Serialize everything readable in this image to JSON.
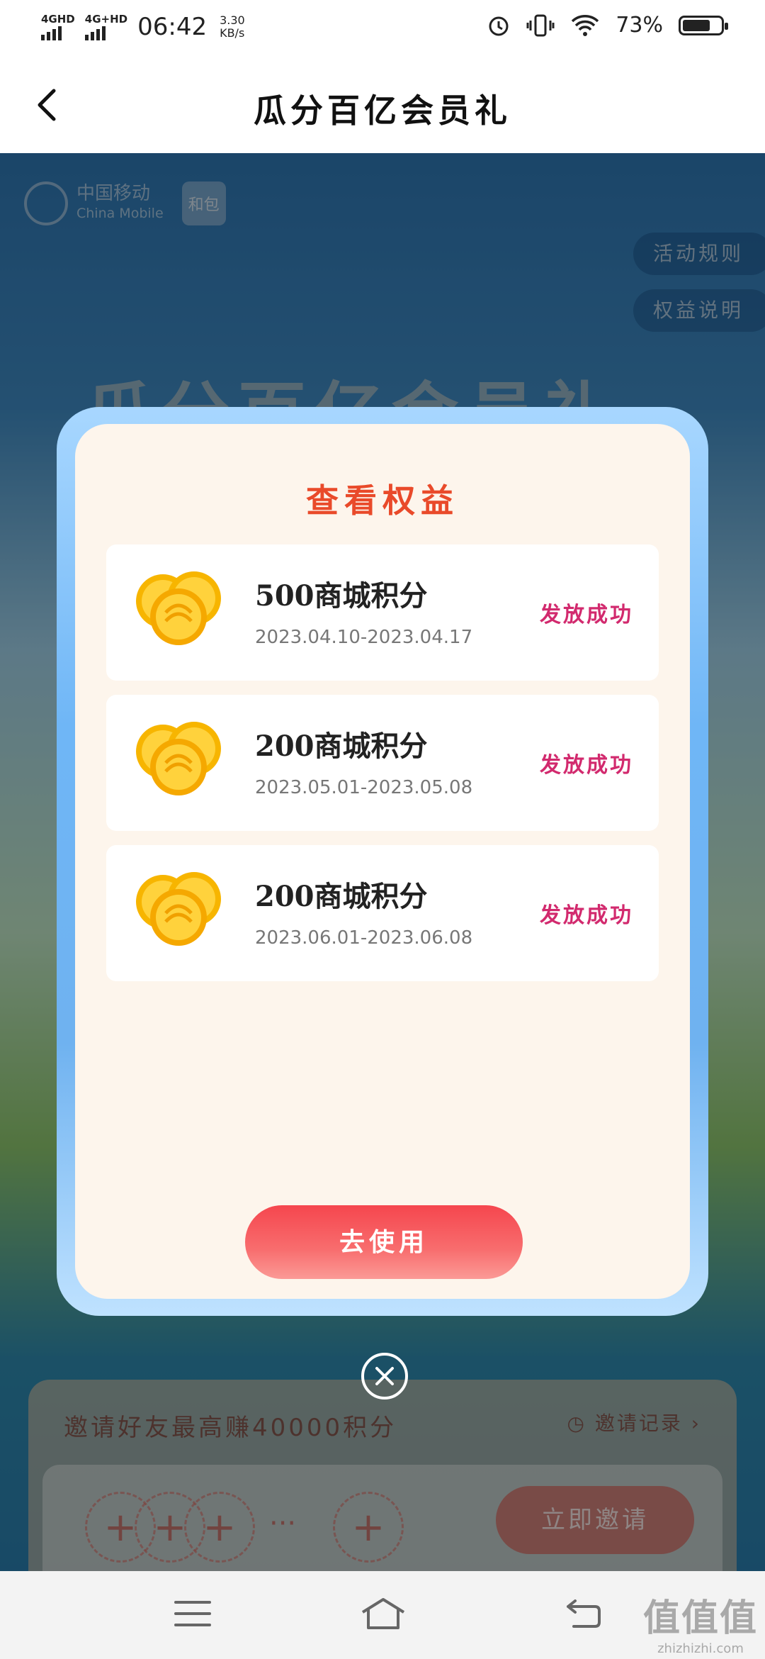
{
  "status_bar": {
    "network1": "4G",
    "network1_sup": "HD",
    "network2": "4G",
    "network2_sup": "+HD",
    "time": "06:42",
    "speed_value": "3.30",
    "speed_unit": "KB/s",
    "battery": "73%",
    "battery_level": 0.73
  },
  "header": {
    "title": "瓜分百亿会员礼",
    "back_icon": "chevron-left-icon"
  },
  "background_page": {
    "brand_cn": "中国移动",
    "brand_en": "China Mobile",
    "hebao": "和包",
    "rules_button": "活动规则",
    "benefits_button": "权益说明",
    "banner_title": "瓜分百亿会员礼",
    "invite_title": "邀请好友最高赚40000积分",
    "invite_record": "邀请记录",
    "invite_button": "立即邀请",
    "invite_more": "···"
  },
  "modal": {
    "title": "查看权益",
    "items": [
      {
        "name": "500商城积分",
        "period": "2023.04.10-2023.04.17",
        "status": "发放成功"
      },
      {
        "name": "200商城积分",
        "period": "2023.05.01-2023.05.08",
        "status": "发放成功"
      },
      {
        "name": "200商城积分",
        "period": "2023.06.01-2023.06.08",
        "status": "发放成功"
      }
    ],
    "use_button": "去使用",
    "close_icon": "close-icon"
  },
  "watermark": {
    "main": "值值值",
    "sub": "zhizhizhi.com"
  },
  "colors": {
    "accent_red": "#e94a2a",
    "status_pink": "#d22a6e",
    "button_red": "#f5464e",
    "frame_blue": "#6fb6f6"
  }
}
